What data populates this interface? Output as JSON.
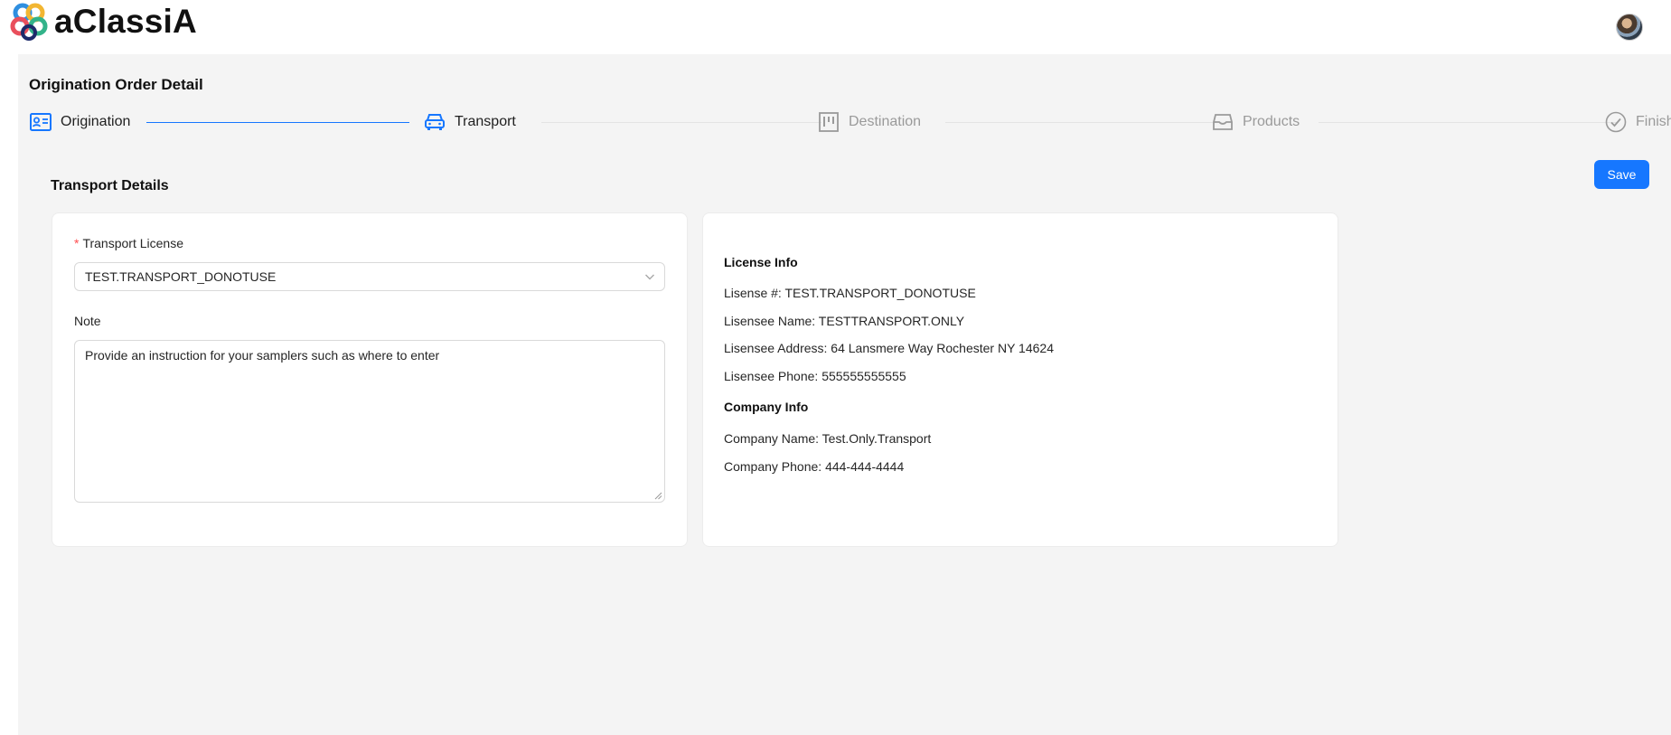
{
  "app": {
    "name": "aClassiA"
  },
  "page": {
    "title": "Origination Order Detail"
  },
  "steps": [
    {
      "label": "Origination",
      "state": "done",
      "icon": "id-card-icon"
    },
    {
      "label": "Transport",
      "state": "active",
      "icon": "car-icon"
    },
    {
      "label": "Destination",
      "state": "wait",
      "icon": "board-icon"
    },
    {
      "label": "Products",
      "state": "wait",
      "icon": "inbox-icon"
    },
    {
      "label": "Finish",
      "state": "wait",
      "icon": "check-circle-icon"
    }
  ],
  "section": {
    "title": "Transport Details",
    "save_label": "Save"
  },
  "form": {
    "license_required_mark": "*",
    "license_label": "Transport License",
    "license_value": "TEST.TRANSPORT_DONOTUSE",
    "note_label": "Note",
    "note_value": "Provide an instruction for your samplers such as where to enter"
  },
  "license_info": {
    "heading": "License Info",
    "license_no": "Lisense #: TEST.TRANSPORT_DONOTUSE",
    "licensee_name": "Lisensee Name: TESTTRANSPORT.ONLY",
    "licensee_address": "Lisensee Address: 64 Lansmere Way Rochester NY 14624",
    "licensee_phone": "Lisensee Phone: 555555555555"
  },
  "company_info": {
    "heading": "Company Info",
    "company_name": "Company Name: Test.Only.Transport",
    "company_phone": "Company Phone: 444-444-4444"
  },
  "colors": {
    "primary": "#1677ff",
    "background": "#f4f4f4",
    "required": "#ff4d4f"
  }
}
